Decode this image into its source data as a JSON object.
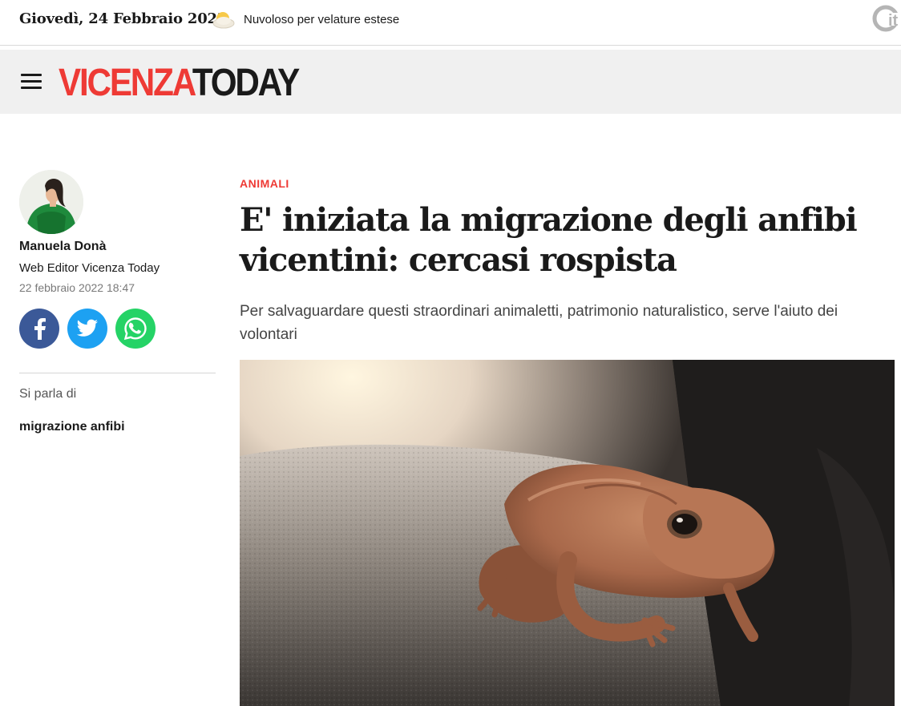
{
  "topbar": {
    "date": "Giovedì, 24 Febbraio 2022",
    "weather_text": "Nuvoloso per velature estese",
    "weather_icon": "cloud-sun-icon",
    "network_icon": "citynews-logo-icon"
  },
  "header": {
    "menu_icon": "hamburger-menu-icon",
    "logo_part1": "VICENZA",
    "logo_part2": "TODAY",
    "logo_color_1": "#ee3a35",
    "logo_color_2": "#1a1a1a"
  },
  "author": {
    "name": "Manuela Donà",
    "role": "Web Editor Vicenza Today",
    "published": "22 febbraio 2022 18:47"
  },
  "share": {
    "facebook_icon": "facebook-icon",
    "twitter_icon": "twitter-icon",
    "whatsapp_icon": "whatsapp-icon"
  },
  "topics": {
    "label": "Si parla di",
    "items": [
      "migrazione anfibi"
    ]
  },
  "article": {
    "category": "ANIMALI",
    "category_color": "#ee3a35",
    "title": "E' iniziata la migrazione degli anfibi vicentini: cercasi rospista",
    "subtitle": "Per salvaguardare questi straordinari animaletti, patrimonio naturalistico, serve l'aiuto dei volontari"
  }
}
